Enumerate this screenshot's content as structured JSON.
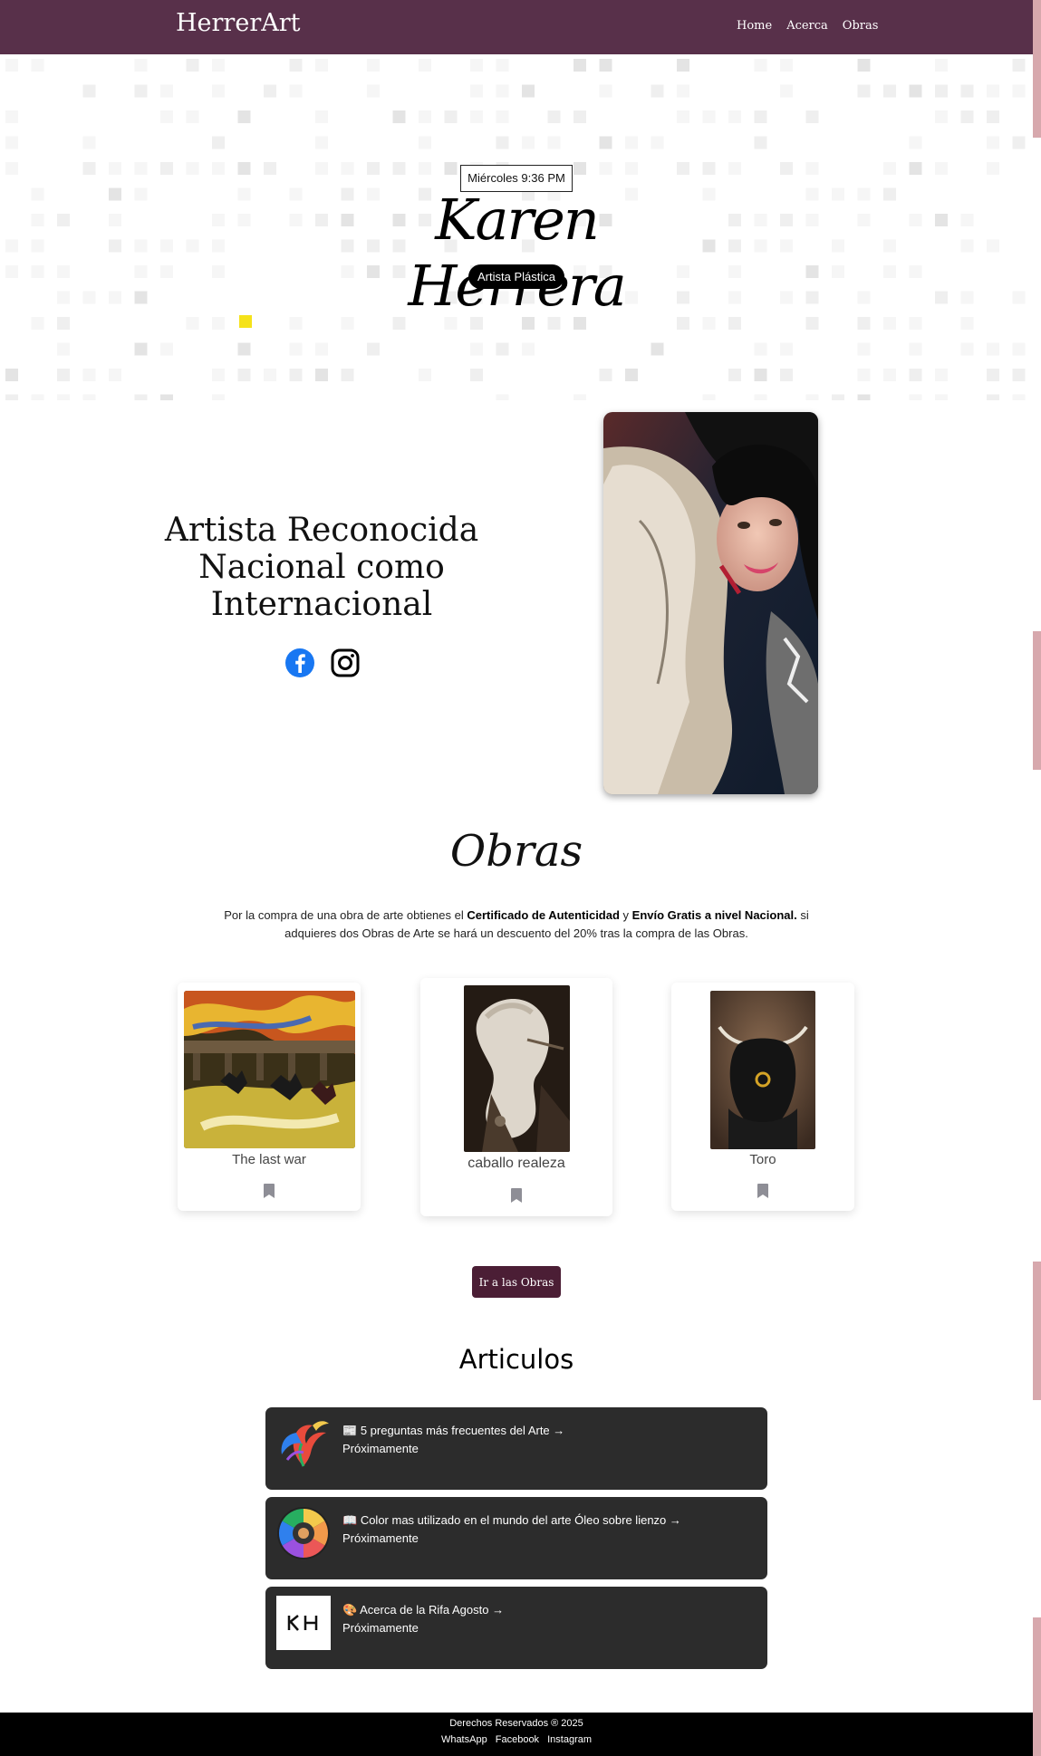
{
  "nav": {
    "brand": "HerrerArt",
    "links": [
      "Home",
      "Acerca",
      "Obras"
    ]
  },
  "hero": {
    "datetime": "Miércoles 9:36 PM",
    "name": "Karen Herrera",
    "badge": "Artista Plástica"
  },
  "about": {
    "headline": "Artista Reconocida Nacional como Internacional",
    "social": [
      "facebook-icon",
      "instagram-icon"
    ]
  },
  "obras": {
    "title": "Obras",
    "text_before": "Por la compra de una obra de arte obtienes el ",
    "bold1": "Certificado de Autenticidad",
    "text_mid": " y ",
    "bold2": "Envío Gratis a nivel Nacional.",
    "text_after": " si adquieres dos Obras de Arte se hará un descuento del 20% tras la compra de las Obras.",
    "cards": [
      {
        "title": "The last war"
      },
      {
        "title": "caballo realeza"
      },
      {
        "title": "Toro"
      }
    ],
    "cta": "Ir a las Obras"
  },
  "articulos": {
    "title": "Articulos",
    "items": [
      {
        "icon": "📰",
        "title": "5 preguntas más frecuentes del Arte →",
        "status": "Próximamente"
      },
      {
        "icon": "📖",
        "title": "Color mas utilizado en el mundo del arte Óleo sobre lienzo →",
        "status": "Próximamente"
      },
      {
        "icon": "🎨",
        "title": "Acerca de la Rifa Agosto →",
        "status": "Próximamente"
      }
    ]
  },
  "footer": {
    "rights": "Derechos Reservados ® 2025",
    "links": [
      "WhatsApp",
      "Facebook",
      "Instagram"
    ]
  },
  "colors": {
    "navbar": "#58304a",
    "accent_strip": "#d7a8ad",
    "cta": "#4b1e35",
    "article_card": "#2c2c2c"
  }
}
